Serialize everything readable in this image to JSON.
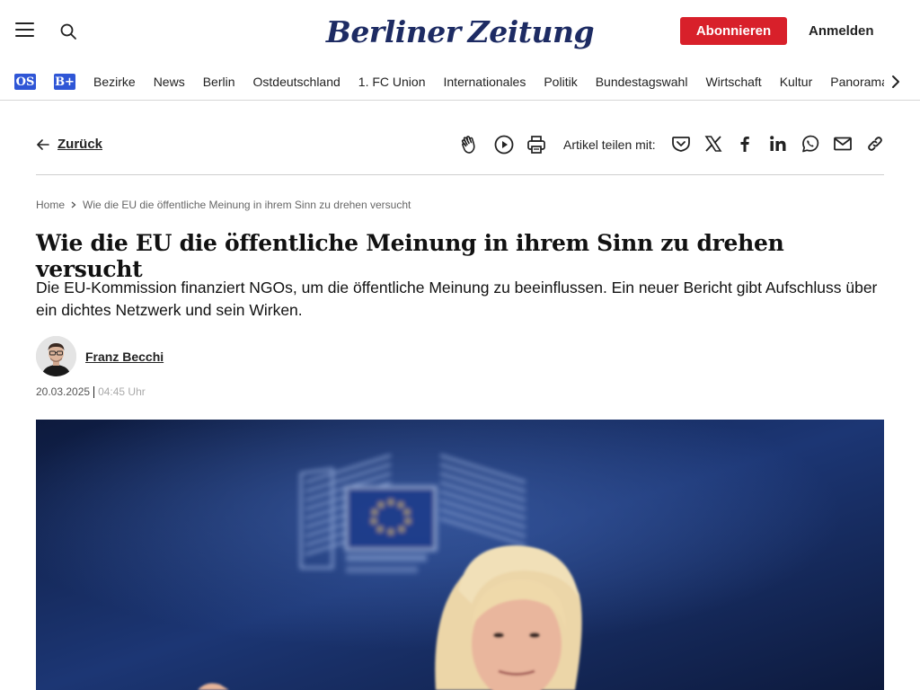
{
  "header": {
    "logo_text_left": "Berliner",
    "logo_text_right": "Zeitung",
    "subscribe_label": "Abonnieren",
    "login_label": "Anmelden"
  },
  "nav": {
    "badges": [
      "OS",
      "B+"
    ],
    "items": [
      "Bezirke",
      "News",
      "Berlin",
      "Ostdeutschland",
      "1. FC Union",
      "Internationales",
      "Politik",
      "Bundestagswahl",
      "Wirtschaft",
      "Kultur",
      "Panorama"
    ]
  },
  "toolbar": {
    "back_label": "Zurück",
    "share_label": "Artikel teilen mit:"
  },
  "breadcrumb": {
    "home": "Home",
    "current": "Wie die EU die öffentliche Meinung in ihrem Sinn zu drehen versucht"
  },
  "article": {
    "headline": "Wie die EU die öffentliche Meinung in ihrem Sinn zu drehen versucht",
    "teaser": "Die EU-Kommission finanziert NGOs, um die öffentliche Meinung zu beeinflussen. Ein neuer Bericht gibt Aufschluss über ein dichtes Netzwerk und sein Wirken.",
    "author": "Franz Becchi",
    "date": "20.03.2025",
    "time": "04:45 Uhr"
  },
  "colors": {
    "accent_red": "#d8202a",
    "brand_blue": "#1d2b63",
    "badge_blue": "#2f56d6"
  },
  "icons": [
    "menu-icon",
    "search-icon",
    "chevron-right-icon",
    "arrow-left-icon",
    "clap-icon",
    "play-icon",
    "print-icon",
    "pocket-icon",
    "x-icon",
    "facebook-icon",
    "linkedin-icon",
    "whatsapp-icon",
    "mail-icon",
    "link-icon"
  ]
}
